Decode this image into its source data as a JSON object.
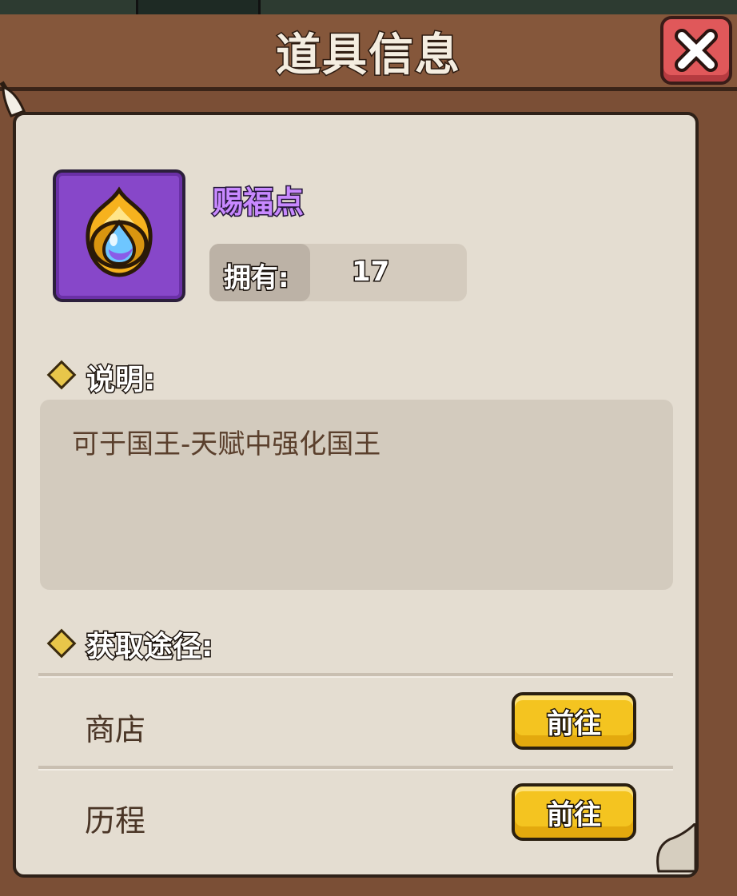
{
  "dialog": {
    "title": "道具信息",
    "close_icon": "close-x-icon"
  },
  "item": {
    "name": "赐福点",
    "icon": "flame-gem-icon",
    "owned_label": "拥有:",
    "owned_value": "17"
  },
  "description": {
    "label": "说明:",
    "text": "可于国王-天赋中强化国王"
  },
  "sources": {
    "label": "获取途径:",
    "items": [
      {
        "name": "商店",
        "button": "前往"
      },
      {
        "name": "历程",
        "button": "前往"
      }
    ]
  },
  "colors": {
    "frame": "#7b4f36",
    "panel": "#e4ddd1",
    "item_name": "#c889ff",
    "icon_bg": "#8747c9",
    "go_button": "#f4c420",
    "close_button": "#e0585a"
  }
}
